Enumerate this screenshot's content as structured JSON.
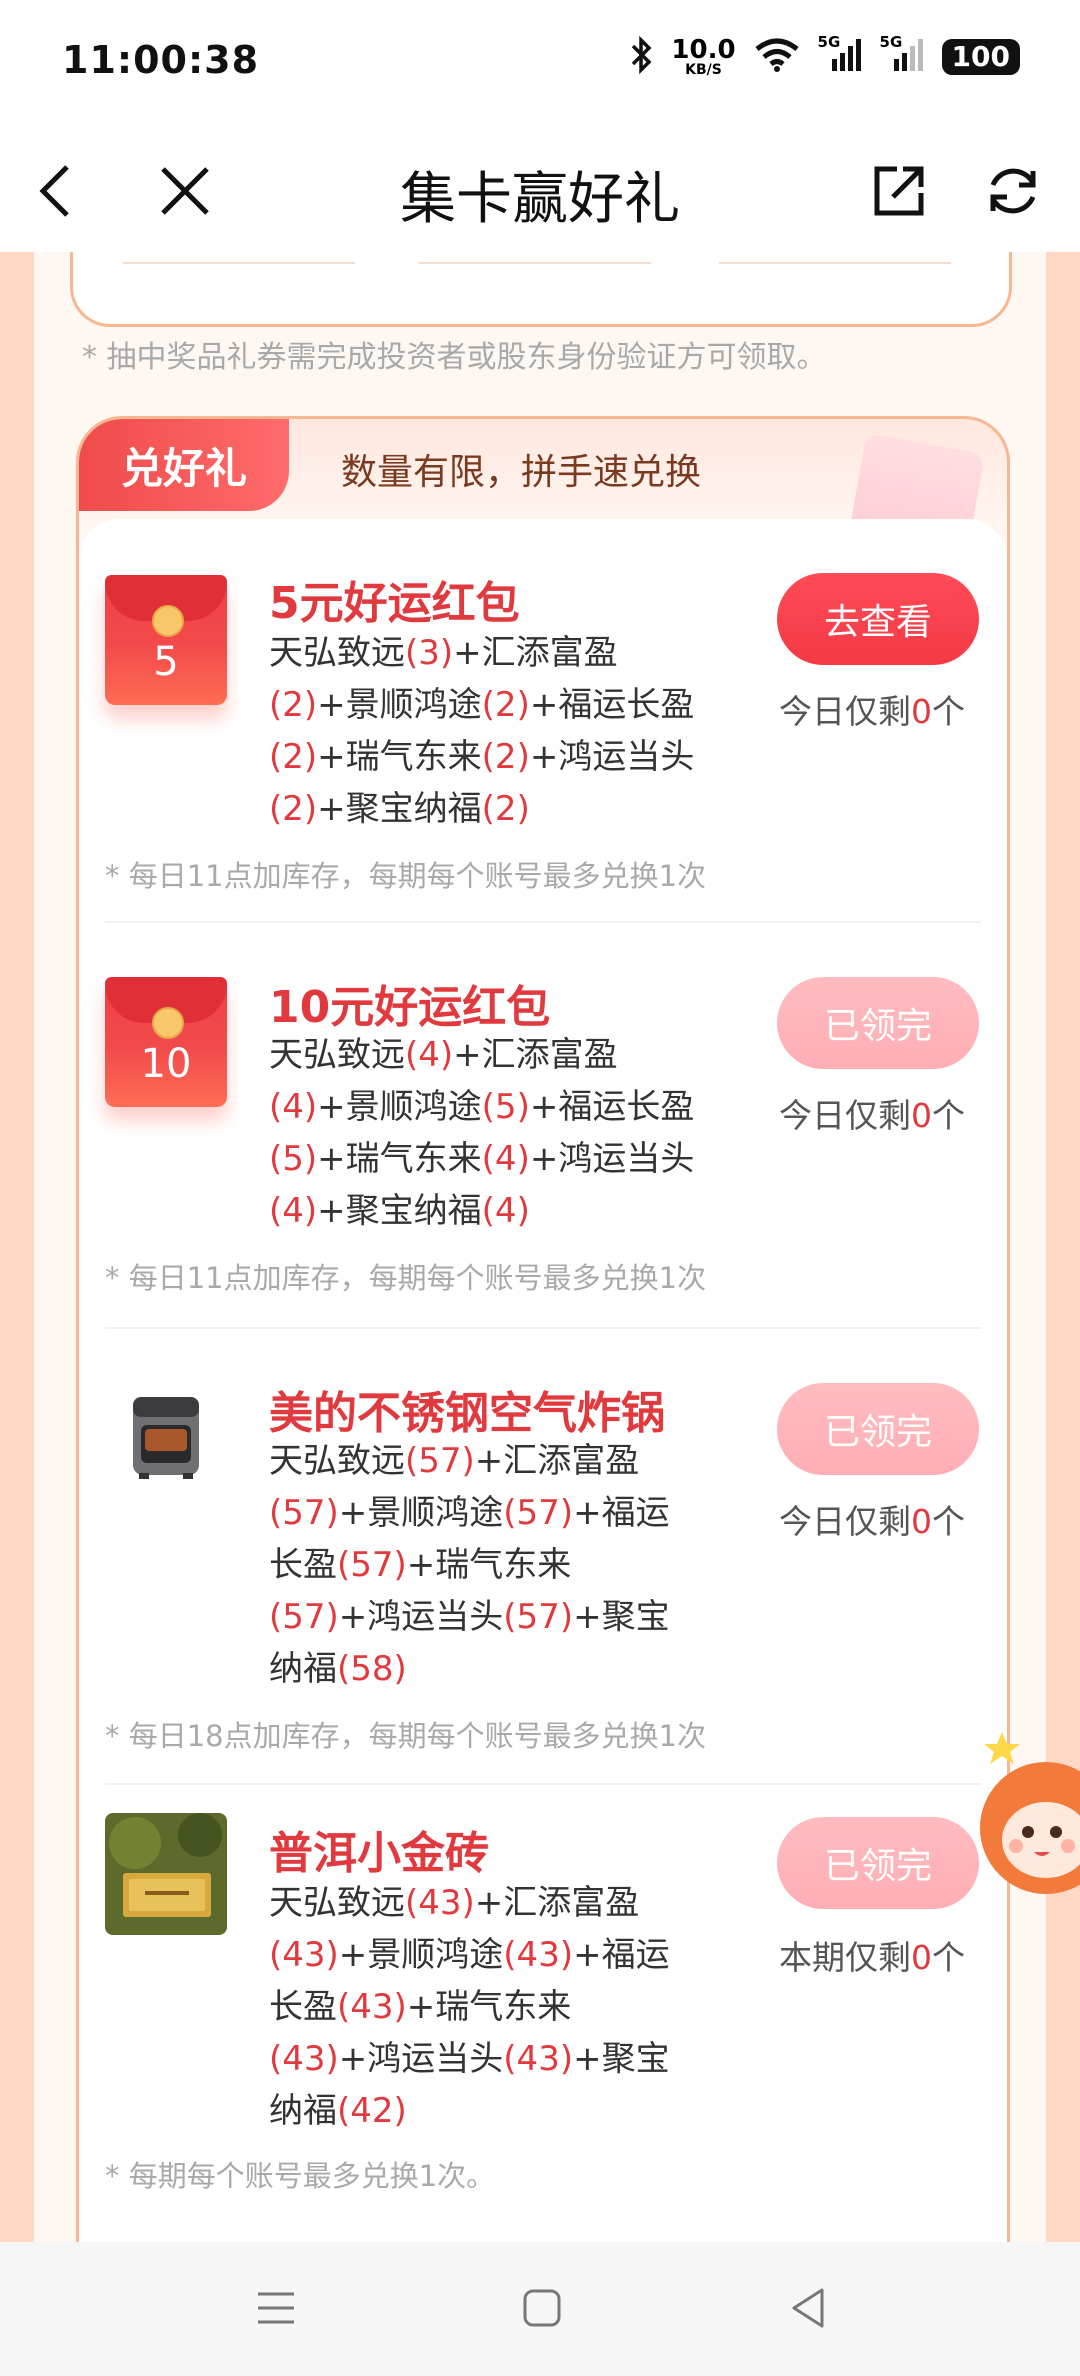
{
  "status_bar": {
    "time": "11:00:38",
    "net_speed_value": "10.0",
    "net_speed_unit": "KB/S",
    "signal1": "5G",
    "signal2": "5G",
    "battery": "100"
  },
  "nav": {
    "title": "集卡赢好礼"
  },
  "verify_note": "* 抽中奖品礼券需完成投资者或股东身份验证方可领取。",
  "exchange": {
    "tab_label": "兑好礼",
    "subtitle": "数量有限，拼手速兑换",
    "items": [
      {
        "title": "5元好运红包",
        "envelope_num": "5",
        "desc": [
          {
            "t": "天弘致远"
          },
          {
            "t": "(3)",
            "n": true
          },
          {
            "t": "+汇添富盈"
          },
          {
            "t": "(2)",
            "n": true
          },
          {
            "t": "+景顺鸿途"
          },
          {
            "t": "(2)",
            "n": true
          },
          {
            "t": "+福运长盈"
          },
          {
            "t": "(2)",
            "n": true
          },
          {
            "t": "+瑞气东来"
          },
          {
            "t": "(2)",
            "n": true
          },
          {
            "t": "+鸿运当头"
          },
          {
            "t": "(2)",
            "n": true
          },
          {
            "t": "+聚宝纳福"
          },
          {
            "t": "(2)",
            "n": true
          }
        ],
        "button": "去查看",
        "remain_prefix": "今日仅剩",
        "remain_count": "0",
        "remain_suffix": "个",
        "note": "* 每日11点加库存，每期每个账号最多兑换1次"
      },
      {
        "title": "10元好运红包",
        "envelope_num": "10",
        "desc": [
          {
            "t": "天弘致远"
          },
          {
            "t": "(4)",
            "n": true
          },
          {
            "t": "+汇添富盈"
          },
          {
            "t": "(4)",
            "n": true
          },
          {
            "t": "+景顺鸿途"
          },
          {
            "t": "(5)",
            "n": true
          },
          {
            "t": "+福运长盈"
          },
          {
            "t": "(5)",
            "n": true
          },
          {
            "t": "+瑞气东来"
          },
          {
            "t": "(4)",
            "n": true
          },
          {
            "t": "+鸿运当头"
          },
          {
            "t": "(4)",
            "n": true
          },
          {
            "t": "+聚宝纳福"
          },
          {
            "t": "(4)",
            "n": true
          }
        ],
        "button": "已领完",
        "remain_prefix": "今日仅剩",
        "remain_count": "0",
        "remain_suffix": "个",
        "note": "* 每日11点加库存，每期每个账号最多兑换1次"
      },
      {
        "title": "美的不锈钢空气炸锅",
        "desc": [
          {
            "t": "天弘致远"
          },
          {
            "t": "(57)",
            "n": true
          },
          {
            "t": "+汇添富盈"
          },
          {
            "t": "(57)",
            "n": true
          },
          {
            "t": "+景顺鸿途"
          },
          {
            "t": "(57)",
            "n": true
          },
          {
            "t": "+福运长盈"
          },
          {
            "t": "(57)",
            "n": true
          },
          {
            "t": "+瑞气东来"
          },
          {
            "t": "(57)",
            "n": true
          },
          {
            "t": "+鸿运当头"
          },
          {
            "t": "(57)",
            "n": true
          },
          {
            "t": "+聚宝纳福"
          },
          {
            "t": "(58)",
            "n": true
          }
        ],
        "button": "已领完",
        "remain_prefix": "今日仅剩",
        "remain_count": "0",
        "remain_suffix": "个",
        "note": "* 每日18点加库存，每期每个账号最多兑换1次"
      },
      {
        "title": "普洱小金砖",
        "desc": [
          {
            "t": "天弘致远"
          },
          {
            "t": "(43)",
            "n": true
          },
          {
            "t": "+汇添富盈"
          },
          {
            "t": "(43)",
            "n": true
          },
          {
            "t": "+景顺鸿途"
          },
          {
            "t": "(43)",
            "n": true
          },
          {
            "t": "+福运长盈"
          },
          {
            "t": "(43)",
            "n": true
          },
          {
            "t": "+瑞气东来"
          },
          {
            "t": "(43)",
            "n": true
          },
          {
            "t": "+鸿运当头"
          },
          {
            "t": "(43)",
            "n": true
          },
          {
            "t": "+聚宝纳福"
          },
          {
            "t": "(42)",
            "n": true
          }
        ],
        "button": "已领完",
        "remain_prefix": "本期仅剩",
        "remain_count": "0",
        "remain_suffix": "个",
        "note": "* 每期每个账号最多兑换1次。"
      }
    ]
  },
  "colors": {
    "accent_red": "#e0393e",
    "page_bg": "#ffd9c5",
    "button_active": "#f33a45",
    "button_done": "#ffaeb4"
  }
}
